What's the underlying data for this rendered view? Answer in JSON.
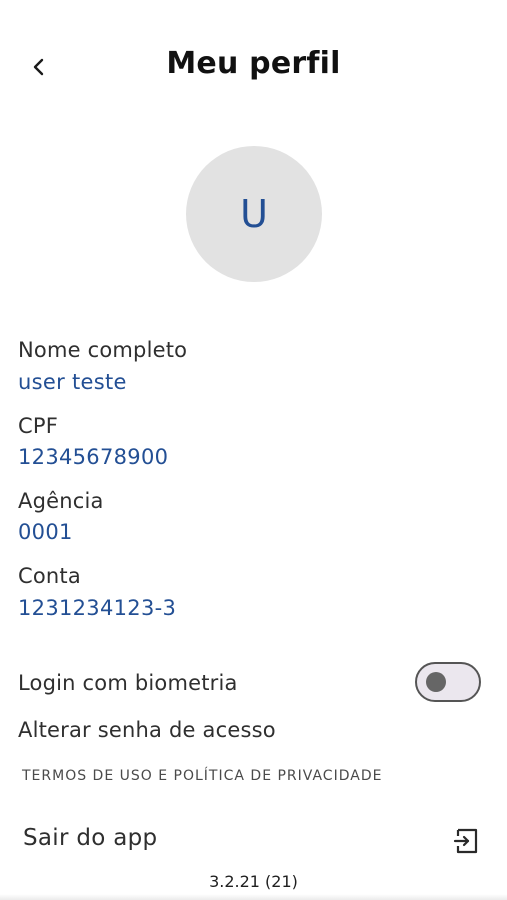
{
  "header": {
    "title": "Meu perfil",
    "back_icon": "chevron-left-icon"
  },
  "avatar": {
    "initial": "U"
  },
  "profile": {
    "name_label": "Nome completo",
    "name_value": "user teste",
    "cpf_label": "CPF",
    "cpf_value": "12345678900",
    "agency_label": "Agência",
    "agency_value": "0001",
    "account_label": "Conta",
    "account_value": "1231234123-3"
  },
  "settings": {
    "biometric_label": "Login com biometria",
    "biometric_enabled": false,
    "change_password_label": "Alterar senha de acesso",
    "terms_label": "TERMOS DE USO E POLÍTICA DE PRIVACIDADE"
  },
  "logout": {
    "label": "Sair do app",
    "icon": "logout-icon"
  },
  "version": "3.2.21 (21)",
  "colors": {
    "accent": "#234f94",
    "avatar_bg": "#e2e2e2",
    "text": "#2f2f2f"
  }
}
